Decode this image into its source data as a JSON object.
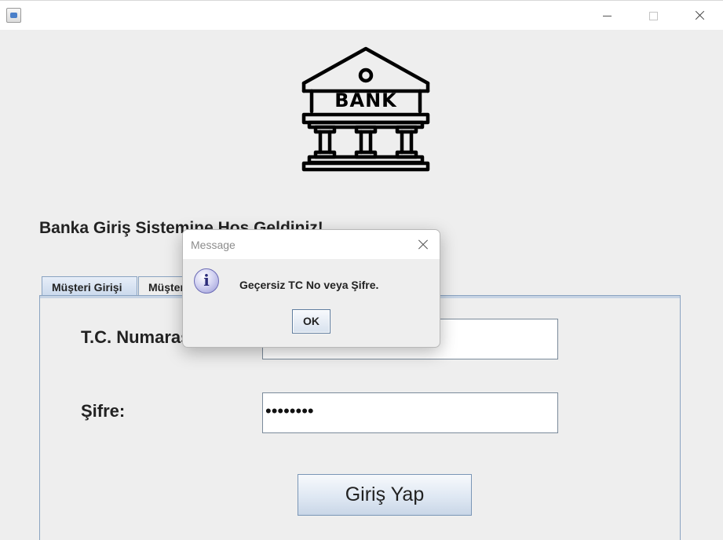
{
  "window": {
    "title": "",
    "controls": {
      "minimize": "minimize-icon",
      "maximize": "maximize-icon",
      "close": "close-icon"
    }
  },
  "logo": {
    "icon": "bank-building-icon",
    "text": "BANK"
  },
  "welcome_text": "Banka Giriş Sistemine Hoş Geldiniz!",
  "tabs": [
    {
      "label": "Müşteri Girişi",
      "selected": true
    },
    {
      "label": "Müşteri Kaydı",
      "selected": false
    }
  ],
  "form": {
    "tc_label": "T.C. Numarası:",
    "tc_value": "",
    "password_label": "Şifre:",
    "password_value": "••••••••",
    "login_button": "Giriş Yap"
  },
  "dialog": {
    "title": "Message",
    "icon": "info-icon",
    "message": "Geçersiz TC No veya Şifre.",
    "ok_button": "OK"
  },
  "colors": {
    "tab_border": "#8aa3c1",
    "button_blue": "#c9d6e7",
    "dialog_icon": "#9898d6"
  }
}
